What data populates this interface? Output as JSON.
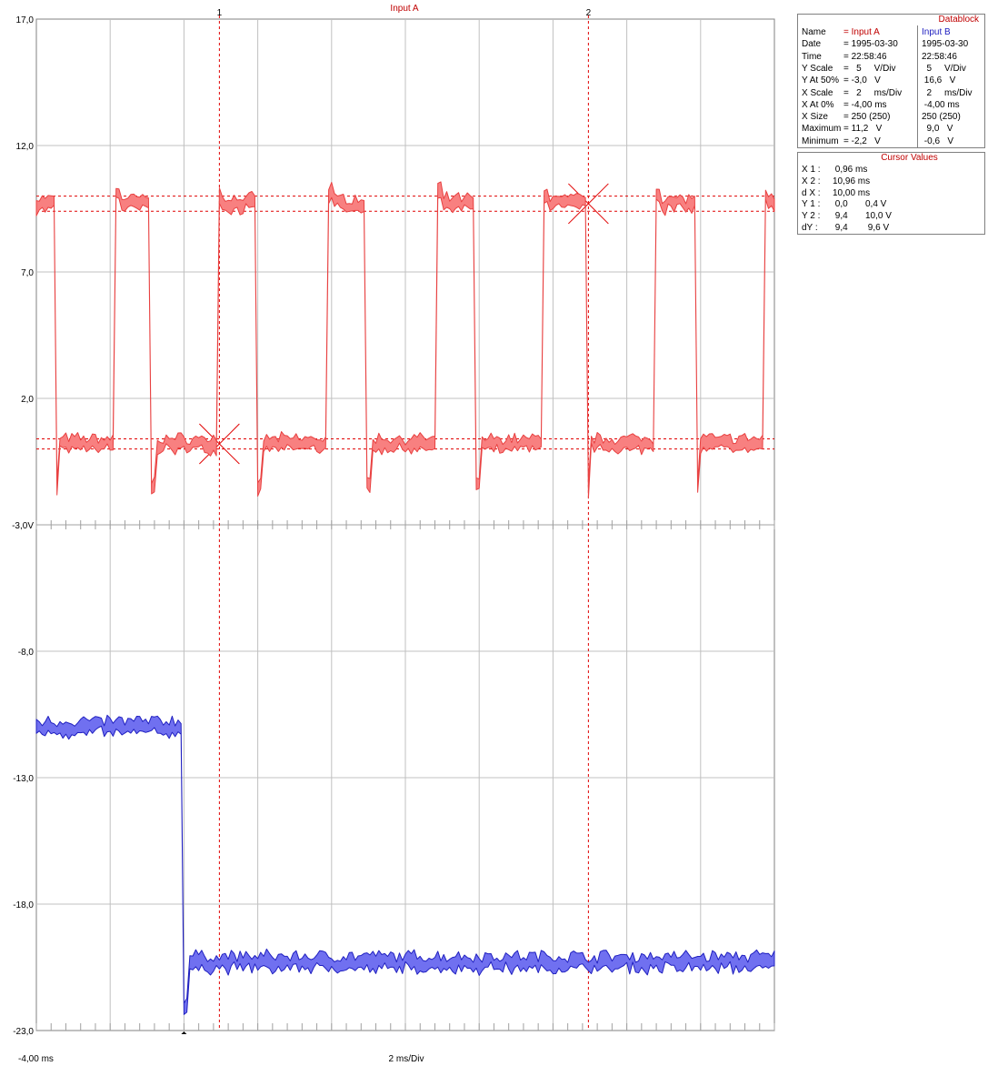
{
  "chart_data": {
    "type": "line",
    "title": "Input A",
    "x_axis": {
      "min_label": "-4,00 ms",
      "center_label": "2 ms/Div",
      "range_ms": [
        -4,
        16
      ],
      "divisions": 10
    },
    "y_axis": {
      "range": [
        -23,
        17
      ],
      "tick_labels": [
        "17,0",
        "12,0",
        "7,0",
        "2,0",
        "-3,0V",
        "-8,0",
        "-13,0",
        "-18,0",
        "-23,0"
      ]
    },
    "cursors": [
      {
        "label": "1",
        "x_ms": 0.96
      },
      {
        "label": "2",
        "x_ms": 10.96
      }
    ],
    "cursor_levels": [
      {
        "name": "Y1 low",
        "y": 0.0
      },
      {
        "name": "Y1 high",
        "y": 0.4
      },
      {
        "name": "Y2 low",
        "y": 9.4
      },
      {
        "name": "Y2 high",
        "y": 10.0
      }
    ],
    "series": [
      {
        "name": "Input A",
        "color": "#e84040",
        "fill": "#f88080",
        "low_level": 0.2,
        "high_level": 9.7,
        "band": 0.45,
        "edges_ms": [
          -3.5,
          -1.85,
          -0.9,
          0.9,
          2.0,
          3.9,
          4.95,
          6.85,
          7.9,
          9.75,
          10.9,
          12.8,
          13.85,
          15.7
        ],
        "first_state": "high"
      },
      {
        "name": "Input B",
        "color": "#2020c0",
        "fill": "#7070f0",
        "high_level": -11.0,
        "low_level": -20.3,
        "band": 0.5,
        "edges_ms": [
          0.0
        ],
        "first_state": "high"
      }
    ]
  },
  "datablock": {
    "title": "Datablock",
    "rows": [
      {
        "label": "Name",
        "a": "= Input A",
        "b": "Input B"
      },
      {
        "label": "Date",
        "a": "= 1995-03-30",
        "b": "1995-03-30"
      },
      {
        "label": "Time",
        "a": "= 22:58:46",
        "b": "22:58:46"
      },
      {
        "label": "Y Scale",
        "a": "=   5     V/Div",
        "b": "  5     V/Div"
      },
      {
        "label": "Y At 50%",
        "a": "= -3,0   V",
        "b": " 16,6   V"
      },
      {
        "label": "X Scale",
        "a": "=   2     ms/Div",
        "b": "  2     ms/Div"
      },
      {
        "label": "X At 0%",
        "a": "= -4,00 ms",
        "b": " -4,00 ms"
      },
      {
        "label": "X Size",
        "a": "= 250 (250)",
        "b": "250 (250)"
      },
      {
        "label": "Maximum",
        "a": "= 11,2   V",
        "b": "  9,0   V"
      },
      {
        "label": "Minimum",
        "a": "= -2,2   V",
        "b": " -0,6   V"
      }
    ]
  },
  "cursor_values": {
    "title": "Cursor Values",
    "rows": [
      {
        "label": "X 1 :",
        "a": " 0,96 ms",
        "b": ""
      },
      {
        "label": "X 2 :",
        "a": "10,96 ms",
        "b": ""
      },
      {
        "label": "d X :",
        "a": "10,00 ms",
        "b": ""
      },
      {
        "label": "Y 1 :",
        "a": " 0,0",
        "b": "0,4 V"
      },
      {
        "label": "Y 2 :",
        "a": " 9,4",
        "b": "10,0 V"
      },
      {
        "label": "dY :",
        "a": " 9,4",
        "b": " 9,6 V"
      }
    ]
  },
  "colors": {
    "grid": "#c0c0c0",
    "input_a": "#e84040",
    "input_b": "#2020c0",
    "cursor": "#e00000"
  }
}
